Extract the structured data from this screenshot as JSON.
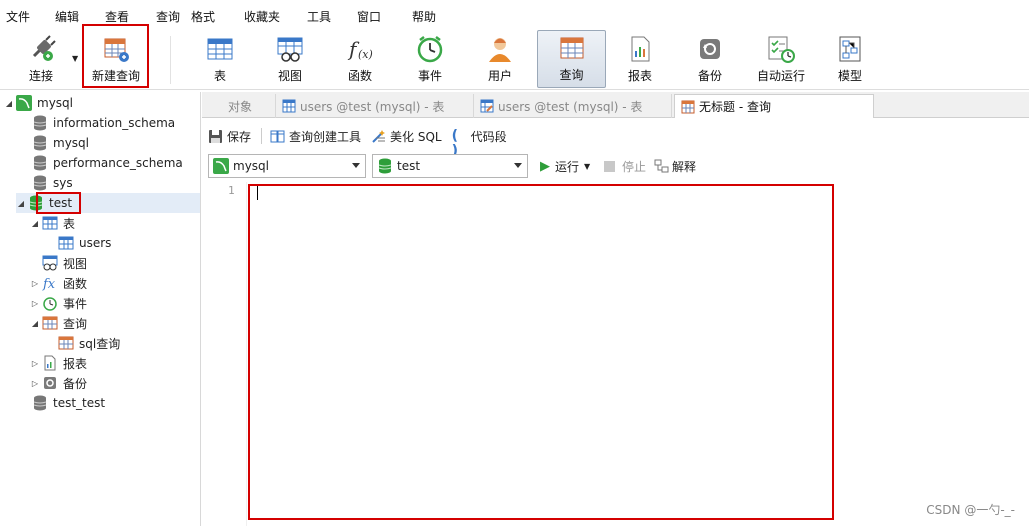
{
  "menu": [
    "文件",
    "编辑",
    "查看",
    "查询",
    "格式",
    "收藏夹",
    "工具",
    "窗口",
    "帮助"
  ],
  "toolbar": {
    "connect": "连接",
    "new_query": "新建查询",
    "table": "表",
    "view": "视图",
    "function": "函数",
    "event": "事件",
    "user": "用户",
    "query": "查询",
    "report": "报表",
    "backup": "备份",
    "autorun": "自动运行",
    "model": "模型"
  },
  "tree": {
    "mysql_conn": "mysql",
    "db1": "information_schema",
    "db2": "mysql",
    "db3": "performance_schema",
    "db4": "sys",
    "db5": "test",
    "tables": "表",
    "users": "users",
    "views": "视图",
    "functions": "函数",
    "events": "事件",
    "queries": "查询",
    "sql_query": "sql查询",
    "reports": "报表",
    "backups": "备份",
    "db6": "test_test"
  },
  "tabs": {
    "objects": "对象",
    "tab1": "users @test (mysql) - 表",
    "tab2": "users @test (mysql) - 表",
    "tab3": "无标题 - 查询"
  },
  "query_toolbar": {
    "save": "保存",
    "builder": "查询创建工具",
    "beautify": "美化 SQL",
    "snippet": "代码段"
  },
  "selectors": {
    "connection": "mysql",
    "database": "test",
    "run": "运行",
    "stop": "停止",
    "explain": "解释"
  },
  "editor": {
    "line1": "1"
  },
  "watermark": "CSDN @一勺-_-",
  "colors": {
    "highlight": "#d40000",
    "db_green": "#2e9e3a",
    "folder_blue": "#3a78c8"
  }
}
